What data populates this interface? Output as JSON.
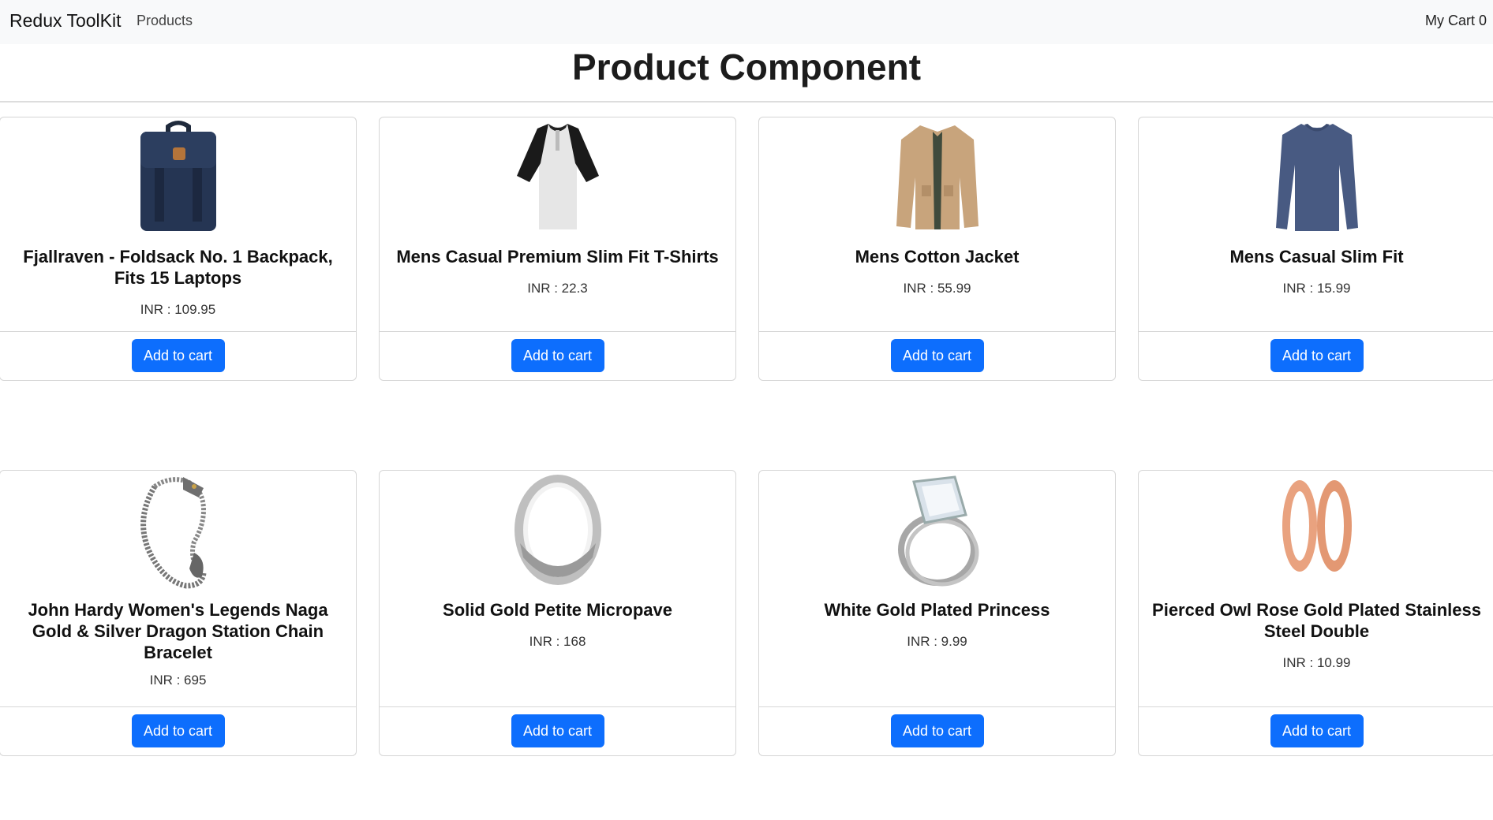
{
  "navbar": {
    "brand": "Redux ToolKit",
    "products_link": "Products",
    "cart_label": "My Cart 0"
  },
  "page": {
    "title": "Product Component"
  },
  "products": [
    {
      "title": "Fjallraven - Foldsack No. 1 Backpack, Fits 15 Laptops",
      "price_text": "INR : 109.95",
      "button": "Add to cart",
      "icon": "backpack-image"
    },
    {
      "title": "Mens Casual Premium Slim Fit T-Shirts",
      "price_text": "INR : 22.3",
      "button": "Add to cart",
      "icon": "tshirt-image"
    },
    {
      "title": "Mens Cotton Jacket",
      "price_text": "INR : 55.99",
      "button": "Add to cart",
      "icon": "jacket-image"
    },
    {
      "title": "Mens Casual Slim Fit",
      "price_text": "INR : 15.99",
      "button": "Add to cart",
      "icon": "longsleeve-shirt-image"
    },
    {
      "title": "John Hardy Women's Legends Naga Gold & Silver Dragon Station Chain Bracelet",
      "price_text": "INR : 695",
      "button": "Add to cart",
      "icon": "bracelet-image"
    },
    {
      "title": "Solid Gold Petite Micropave",
      "price_text": "INR : 168",
      "button": "Add to cart",
      "icon": "silver-ring-image"
    },
    {
      "title": "White Gold Plated Princess",
      "price_text": "INR : 9.99",
      "button": "Add to cart",
      "icon": "diamond-ring-image"
    },
    {
      "title": "Pierced Owl Rose Gold Plated Stainless Steel Double",
      "price_text": "INR : 10.99",
      "button": "Add to cart",
      "icon": "rose-gold-earrings-image"
    }
  ],
  "colors": {
    "navbar_bg": "#f8f9fa",
    "button_bg": "#0d6efd",
    "button_text": "#ffffff",
    "border": "#d6d6d6"
  }
}
